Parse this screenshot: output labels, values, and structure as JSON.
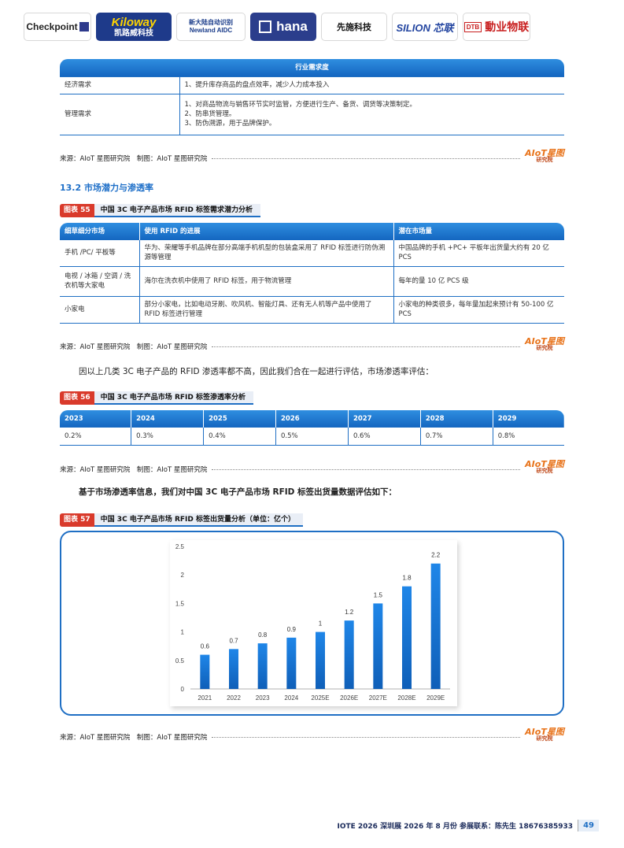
{
  "logos": {
    "checkpoint": "Checkpoint",
    "kiloway_en": "Kiloway",
    "kiloway_cn": "凯路威科技",
    "newland_cn": "新大陆自动识别",
    "newland_en": "Newland AIDC",
    "hana": "hana",
    "sense": "先施科技",
    "silion": "SILION 芯联",
    "dtb_mark": "DTB",
    "dtb": "動业物联"
  },
  "demand_table": {
    "header": "行业需求度",
    "rows": [
      {
        "label": "经济需求",
        "lines": [
          "1、提升库存商品的盘点效率，减少人力成本投入"
        ]
      },
      {
        "label": "管理需求",
        "lines": [
          "1、对商品物流与销售环节实时监管，方便进行生产、备货、调货等决策制定。",
          "2、防串货管理。",
          "3、防伪溯源，用于品牌保护。"
        ]
      }
    ]
  },
  "source_text": "来源：AIoT 星图研究院　制图：AIoT 星图研究院",
  "aiot_logo": {
    "top": "AIoT星图",
    "bottom": "研究院"
  },
  "section_title": "13.2 市场潜力与渗透率",
  "figure55": {
    "tag": "图表 55",
    "title": "中国 3C 电子产品市场 RFID 标签需求潜力分析",
    "headers": [
      "细草细分市场",
      "使用 RFID 的进展",
      "潜在市场量"
    ],
    "rows": [
      [
        "手机 /PC/ 平板等",
        "华为、荣耀等手机品牌在部分高端手机机型的包装盒采用了 RFID 标签进行防伪溯源等管理",
        "中国品牌的手机 +PC+ 平板年出货量大约有 20 亿 PCS"
      ],
      [
        "电视 / 冰箱 / 空调 / 洗衣机等大家电",
        "海尔在洗衣机中使用了 RFID 标签，用于物流管理",
        "每年的量 10 亿 PCS 级"
      ],
      [
        "小家电",
        "部分小家电，比如电动牙刷、吹风机、智能灯具、还有无人机等产品中使用了 RFID 标签进行管理",
        "小家电的种类很多，每年量加起来预计有 50-100 亿 PCS"
      ]
    ]
  },
  "para1": "因以上几类 3C 电子产品的 RFID 渗透率都不高，因此我们合在一起进行评估，市场渗透率评估：",
  "figure56": {
    "tag": "图表 56",
    "title": "中国 3C 电子产品市场 RFID 标签渗透率分析",
    "years": [
      "2023",
      "2024",
      "2025",
      "2026",
      "2027",
      "2028",
      "2029"
    ],
    "rates": [
      "0.2%",
      "0.3%",
      "0.4%",
      "0.5%",
      "0.6%",
      "0.7%",
      "0.8%"
    ]
  },
  "para2": "基于市场渗透率信息，我们对中国 3C 电子产品市场 RFID 标签出货量数据评估如下：",
  "figure57": {
    "tag": "图表 57",
    "title": "中国 3C 电子产品市场 RFID 标签出货量分析（单位：亿个）"
  },
  "chart_data": {
    "type": "bar",
    "categories": [
      "2021",
      "2022",
      "2023",
      "2024",
      "2025E",
      "2026E",
      "2027E",
      "2028E",
      "2029E"
    ],
    "values": [
      0.6,
      0.7,
      0.8,
      0.9,
      1,
      1.2,
      1.5,
      1.8,
      2.2
    ],
    "data_labels": [
      "0.6",
      "0.7",
      "0.8",
      "0.9",
      "1",
      "1.2",
      "1.5",
      "1.8",
      "2.2"
    ],
    "yticks": [
      "0",
      "0.5",
      "1",
      "1.5",
      "2",
      "2.5"
    ],
    "ylim": [
      0,
      2.5
    ],
    "bar_color": "#1a78d6",
    "grid": false
  },
  "footer": {
    "text": "IOTE 2026 深圳展 2026 年 8 月份 参展联系：陈先生 18676385933",
    "page": "49"
  }
}
